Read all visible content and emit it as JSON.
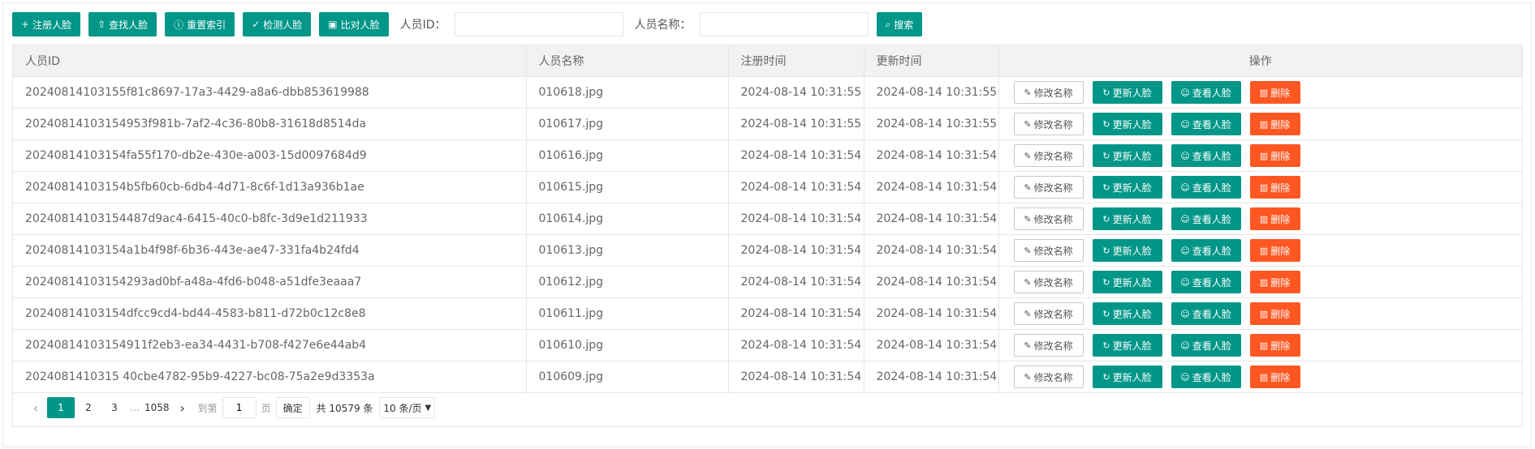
{
  "toolbar": {
    "register_label": "注册人脸",
    "find_label": "查找人脸",
    "reset_label": "重置索引",
    "detect_label": "检测人脸",
    "compare_label": "比对人脸",
    "person_id_label": "人员ID：",
    "person_id_value": "",
    "person_name_label": "人员名称：",
    "person_name_value": "",
    "search_label": "搜索"
  },
  "table": {
    "headers": [
      "人员ID",
      "人员名称",
      "注册时间",
      "更新时间",
      "操作"
    ],
    "actions": {
      "rename": "修改名称",
      "update": "更新人脸",
      "view": "查看人脸",
      "delete": "删除"
    },
    "rows": [
      {
        "id": "20240814103155f81c8697-17a3-4429-a8a6-dbb853619988",
        "name": "010618.jpg",
        "registered": "2024-08-14 10:31:55",
        "updated": "2024-08-14 10:31:55"
      },
      {
        "id": "20240814103154953f981b-7af2-4c36-80b8-31618d8514da",
        "name": "010617.jpg",
        "registered": "2024-08-14 10:31:55",
        "updated": "2024-08-14 10:31:55"
      },
      {
        "id": "20240814103154fa55f170-db2e-430e-a003-15d0097684d9",
        "name": "010616.jpg",
        "registered": "2024-08-14 10:31:54",
        "updated": "2024-08-14 10:31:54"
      },
      {
        "id": "20240814103154b5fb60cb-6db4-4d71-8c6f-1d13a936b1ae",
        "name": "010615.jpg",
        "registered": "2024-08-14 10:31:54",
        "updated": "2024-08-14 10:31:54"
      },
      {
        "id": "20240814103154487d9ac4-6415-40c0-b8fc-3d9e1d211933",
        "name": "010614.jpg",
        "registered": "2024-08-14 10:31:54",
        "updated": "2024-08-14 10:31:54"
      },
      {
        "id": "20240814103154a1b4f98f-6b36-443e-ae47-331fa4b24fd4",
        "name": "010613.jpg",
        "registered": "2024-08-14 10:31:54",
        "updated": "2024-08-14 10:31:54"
      },
      {
        "id": "20240814103154293ad0bf-a48a-4fd6-b048-a51dfe3eaaa7",
        "name": "010612.jpg",
        "registered": "2024-08-14 10:31:54",
        "updated": "2024-08-14 10:31:54"
      },
      {
        "id": "20240814103154dfcc9cd4-bd44-4583-b811-d72b0c12c8e8",
        "name": "010611.jpg",
        "registered": "2024-08-14 10:31:54",
        "updated": "2024-08-14 10:31:54"
      },
      {
        "id": "20240814103154911f2eb3-ea34-4431-b708-f427e6e44ab4",
        "name": "010610.jpg",
        "registered": "2024-08-14 10:31:54",
        "updated": "2024-08-14 10:31:54"
      },
      {
        "id": "2024081410315 40cbe4782-95b9-4227-bc08-75a2e9d3353a",
        "name": "010609.jpg",
        "registered": "2024-08-14 10:31:54",
        "updated": "2024-08-14 10:31:54"
      }
    ]
  },
  "pagination": {
    "pages": [
      "1",
      "2",
      "3"
    ],
    "ellipsis": "…",
    "last_page": "1058",
    "goto_label": "到第",
    "goto_value": "1",
    "page_unit": "页",
    "confirm_label": "确定",
    "total_text": "共 10579 条",
    "page_size": "10 条/页"
  },
  "colors": {
    "primary": "#009688",
    "danger": "#ff5722"
  }
}
